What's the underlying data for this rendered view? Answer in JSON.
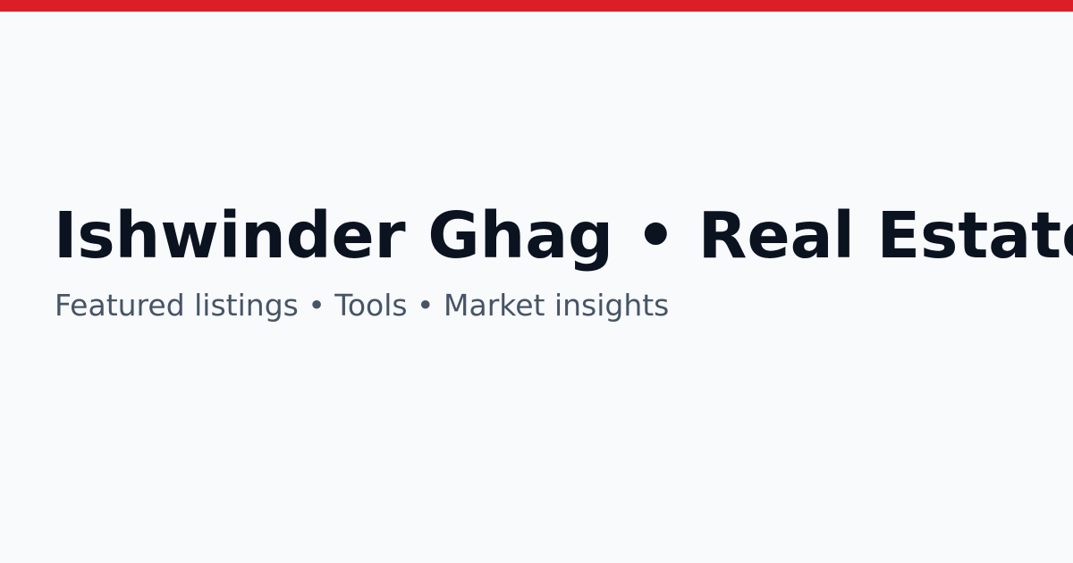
{
  "colors": {
    "accent": "#dc1f26",
    "background": "#f8fafc",
    "title": "#0b1220",
    "subtitle": "#475466"
  },
  "hero": {
    "title": "Ishwinder Ghag • Real Estate",
    "subtitle": "Featured listings • Tools • Market insights"
  }
}
